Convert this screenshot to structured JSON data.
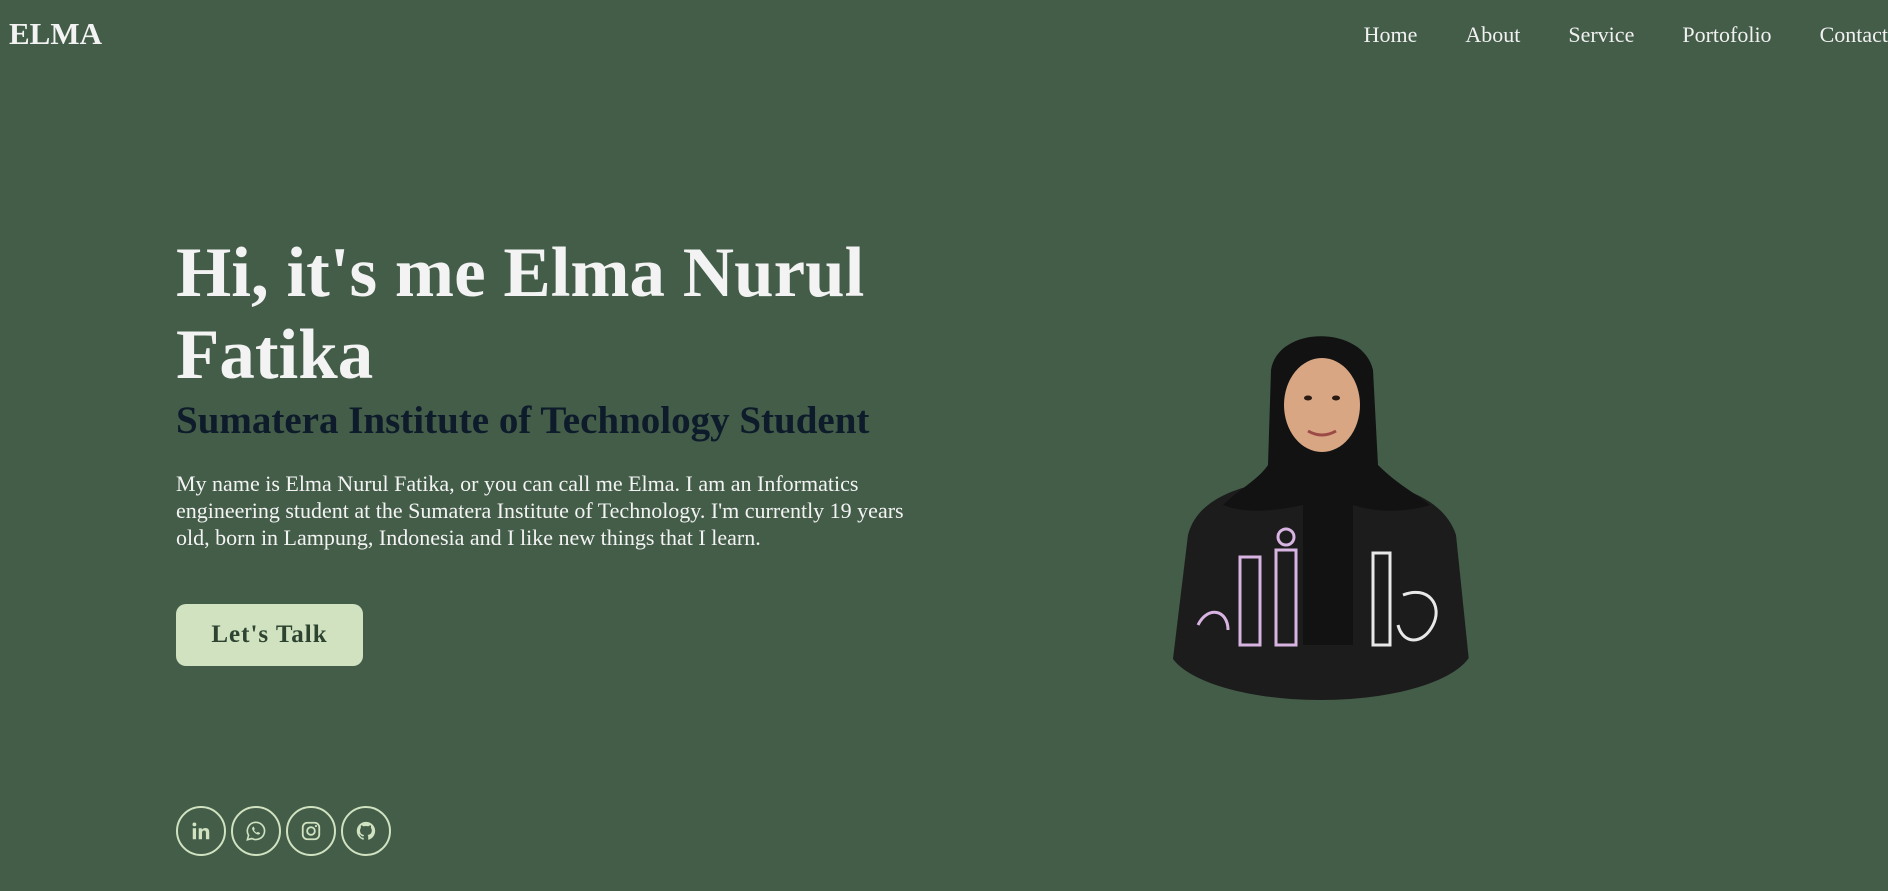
{
  "header": {
    "logo": "ELMA",
    "nav": [
      "Home",
      "About",
      "Service",
      "Portofolio",
      "Contact"
    ]
  },
  "hero": {
    "title": "Hi, it's me Elma Nurul Fatika",
    "subtitle": "Sumatera Institute of Technology Student",
    "description": "My name is Elma Nurul Fatika, or you can call me Elma. I am an Informatics engineering student at the Sumatera Institute of Technology. I'm currently 19 years old, born in Lampung, Indonesia and I like new things that I learn.",
    "cta_label": "Let's Talk"
  },
  "socials": [
    {
      "icon": "linkedin-icon"
    },
    {
      "icon": "whatsapp-icon"
    },
    {
      "icon": "instagram-icon"
    },
    {
      "icon": "github-icon"
    }
  ],
  "colors": {
    "background": "#435d49",
    "accent": "#d0e2c0",
    "subtitle": "#0d1b2a"
  }
}
